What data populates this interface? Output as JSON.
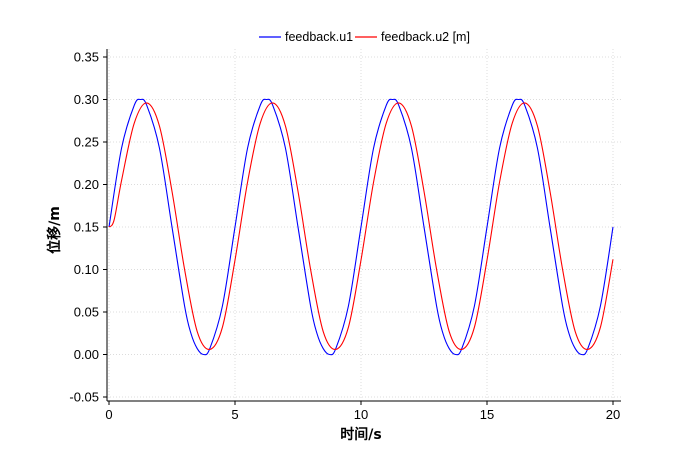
{
  "chart_data": {
    "type": "line",
    "title": "",
    "xlabel": "时间/s",
    "ylabel": "位移/m",
    "xlim": [
      0,
      20
    ],
    "ylim": [
      -0.05,
      0.35
    ],
    "xticks": [
      0,
      5,
      10,
      15,
      20
    ],
    "xtick_labels": [
      "0",
      "5",
      "10",
      "15",
      "20"
    ],
    "yticks": [
      -0.05,
      0.0,
      0.05,
      0.1,
      0.15,
      0.2,
      0.25,
      0.3,
      0.35
    ],
    "ytick_labels": [
      "-0.05",
      "0.00",
      "0.05",
      "0.10",
      "0.15",
      "0.20",
      "0.25",
      "0.30",
      "0.35"
    ],
    "grid": true,
    "legend_position": "top-center",
    "series": [
      {
        "name": "feedback.u1",
        "color": "#0000ff",
        "x": [
          0,
          0.5,
          1,
          1.25,
          1.5,
          2,
          2.5,
          3,
          3.25,
          3.5,
          3.75,
          4,
          4.5,
          5,
          5.5,
          6,
          6.25,
          6.5,
          7,
          7.5,
          8,
          8.25,
          8.5,
          8.75,
          9,
          9.5,
          10,
          10.5,
          11,
          11.25,
          11.5,
          12,
          12.5,
          13,
          13.25,
          13.5,
          13.75,
          14,
          14.5,
          15,
          15.5,
          16,
          16.25,
          16.5,
          17,
          17.5,
          18,
          18.25,
          18.5,
          18.75,
          19,
          19.5,
          20
        ],
        "y": [
          0.15,
          0.243,
          0.293,
          0.3,
          0.293,
          0.243,
          0.15,
          0.057,
          0.025,
          0.007,
          0.0,
          0.007,
          0.057,
          0.15,
          0.243,
          0.293,
          0.3,
          0.293,
          0.243,
          0.15,
          0.057,
          0.025,
          0.007,
          0.0,
          0.007,
          0.057,
          0.15,
          0.243,
          0.293,
          0.3,
          0.293,
          0.243,
          0.15,
          0.057,
          0.025,
          0.007,
          0.0,
          0.007,
          0.057,
          0.15,
          0.243,
          0.293,
          0.3,
          0.293,
          0.243,
          0.15,
          0.057,
          0.025,
          0.007,
          0.0,
          0.007,
          0.057,
          0.15
        ]
      },
      {
        "name": "feedback.u2 [m]",
        "color": "#ff0000",
        "x": [
          0,
          0.2,
          0.5,
          1,
          1.5,
          2,
          2.5,
          3,
          3.5,
          4,
          4.5,
          5,
          5.5,
          6,
          6.5,
          7,
          7.5,
          8,
          8.5,
          9,
          9.5,
          10,
          10.5,
          11,
          11.5,
          12,
          12.5,
          13,
          13.5,
          14,
          14.5,
          15,
          15.5,
          16,
          16.5,
          17,
          17.5,
          18,
          18.5,
          19,
          19.5,
          20
        ],
        "y": [
          0.15,
          0.158,
          0.205,
          0.272,
          0.296,
          0.269,
          0.192,
          0.1,
          0.027,
          0.006,
          0.032,
          0.111,
          0.203,
          0.272,
          0.296,
          0.269,
          0.192,
          0.1,
          0.027,
          0.006,
          0.032,
          0.111,
          0.203,
          0.272,
          0.296,
          0.269,
          0.192,
          0.1,
          0.027,
          0.006,
          0.032,
          0.111,
          0.203,
          0.272,
          0.296,
          0.269,
          0.192,
          0.1,
          0.027,
          0.006,
          0.032,
          0.112
        ]
      }
    ]
  }
}
